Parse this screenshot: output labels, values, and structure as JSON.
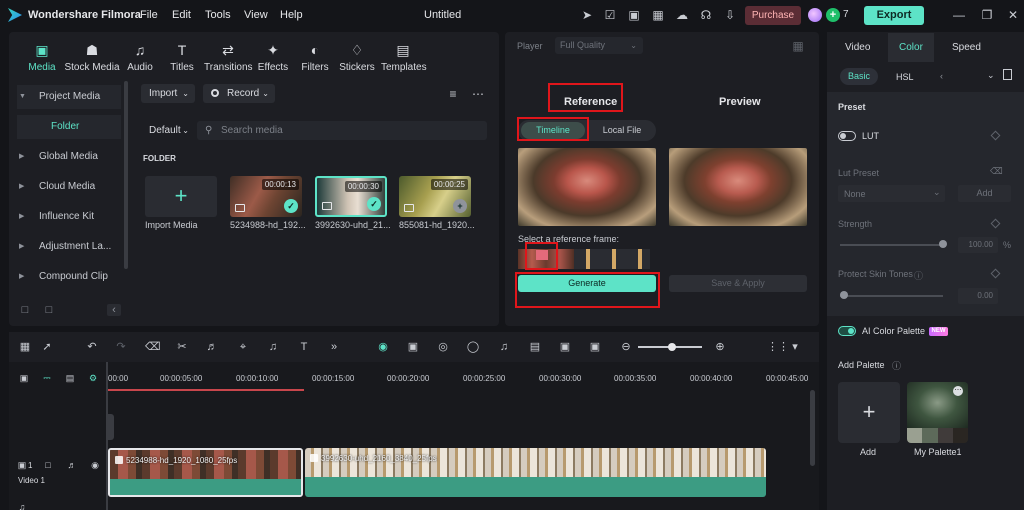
{
  "app": {
    "name": "Wondershare Filmora",
    "menus": [
      "File",
      "Edit",
      "Tools",
      "View",
      "Help"
    ],
    "document_title": "Untitled",
    "purchase_label": "Purchase",
    "credits": "7",
    "export_label": "Export"
  },
  "media_tabs": [
    {
      "label": "Media",
      "icon": "media-icon"
    },
    {
      "label": "Stock Media",
      "icon": "stock-media-icon"
    },
    {
      "label": "Audio",
      "icon": "audio-icon"
    },
    {
      "label": "Titles",
      "icon": "titles-icon"
    },
    {
      "label": "Transitions",
      "icon": "transitions-icon"
    },
    {
      "label": "Effects",
      "icon": "effects-icon"
    },
    {
      "label": "Filters",
      "icon": "filters-icon"
    },
    {
      "label": "Stickers",
      "icon": "stickers-icon"
    },
    {
      "label": "Templates",
      "icon": "templates-icon"
    }
  ],
  "sidebar": {
    "items": [
      {
        "label": "Project Media"
      },
      {
        "label": "Folder"
      },
      {
        "label": "Global Media"
      },
      {
        "label": "Cloud Media"
      },
      {
        "label": "Influence Kit"
      },
      {
        "label": "Adjustment La..."
      },
      {
        "label": "Compound Clip"
      }
    ]
  },
  "media_toolbar": {
    "import_label": "Import",
    "record_label": "Record",
    "sort_label": "Default",
    "search_placeholder": "Search media",
    "folder_heading": "FOLDER"
  },
  "media_items": [
    {
      "label": "Import Media"
    },
    {
      "label": "5234988-hd_192...",
      "duration": "00:00:13"
    },
    {
      "label": "3992630-uhd_21...",
      "duration": "00:00:30"
    },
    {
      "label": "855081-hd_1920...",
      "duration": "00:00:25"
    }
  ],
  "player": {
    "label": "Player",
    "quality": "Full Quality",
    "reference_tab": "Reference",
    "preview_tab": "Preview",
    "timeline_option": "Timeline",
    "localfile_option": "Local File",
    "frame_label": "Select a reference frame:",
    "generate_label": "Generate",
    "save_apply_label": "Save & Apply"
  },
  "properties": {
    "tabs": [
      "Video",
      "Color",
      "Speed"
    ],
    "active_tab": "Color",
    "subtabs": [
      "Basic",
      "HSL"
    ],
    "preset_heading": "Preset",
    "lut_label": "LUT",
    "lut_preset_label": "Lut Preset",
    "lut_preset_value": "None",
    "add_label": "Add",
    "strength_label": "Strength",
    "strength_value": "100.00",
    "strength_unit": "%",
    "strength_level": 1.0,
    "protect_label": "Protect Skin Tones",
    "protect_value": "0.00",
    "protect_level": 0.0,
    "ai_palette_label": "AI Color Palette",
    "new_badge": "NEW",
    "add_palette_label": "Add Palette",
    "palette_add_label": "Add",
    "palette_name": "My Palette1"
  },
  "timeline": {
    "ruler": [
      "00:00",
      "00:00:05:00",
      "00:00:10:00",
      "00:00:15:00",
      "00:00:20:00",
      "00:00:25:00",
      "00:00:30:00",
      "00:00:35:00",
      "00:00:40:00",
      "00:00:45:00"
    ],
    "track_label": "Video 1",
    "track_number": "1",
    "clips": [
      {
        "name": "5234988-hd_1920_1080_25fps"
      },
      {
        "name": "3992630-uhd_2160_3840_25fps"
      }
    ]
  },
  "colors": {
    "accent": "#5de3c7",
    "highlight_box": "#e0161b",
    "panel": "#1d1e23",
    "background": "#141519"
  }
}
